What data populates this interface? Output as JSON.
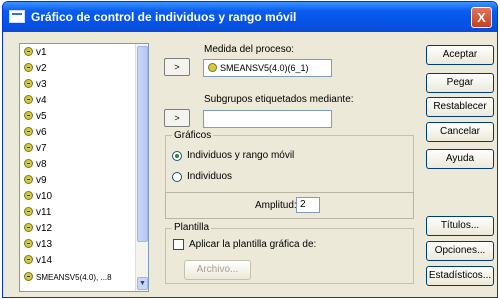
{
  "window": {
    "title": "Gráfico de control de individuos y rango móvil",
    "close_label": "X"
  },
  "variables": {
    "items": [
      "v1",
      "v2",
      "v3",
      "v4",
      "v5",
      "v6",
      "v7",
      "v8",
      "v9",
      "v10",
      "v11",
      "v12",
      "v13",
      "v14",
      "SMEANSV5(4.0), ...8"
    ],
    "scroll_down": "▼"
  },
  "arrow_label": ">",
  "medida": {
    "label": "Medida del proceso:",
    "value": "SMEANSV5(4.0)(6_1)"
  },
  "subgrupos": {
    "label": "Subgrupos etiquetados mediante:",
    "value": ""
  },
  "graficos": {
    "title": "Gráficos",
    "option1": "Individuos y rango móvil",
    "option2": "Individuos",
    "amplitud_label": "Amplitud:",
    "amplitud_value": "2"
  },
  "plantilla": {
    "title": "Plantilla",
    "checkbox_label": "Aplicar la plantilla gráfica de:",
    "archivo_button": "Archivo..."
  },
  "buttons": {
    "aceptar": "Aceptar",
    "pegar": "Pegar",
    "restablecer": "Restablecer",
    "cancelar": "Cancelar",
    "ayuda": "Ayuda",
    "titulos": "Títulos...",
    "opciones": "Opciones...",
    "estadisticos": "Estadísticos..."
  }
}
